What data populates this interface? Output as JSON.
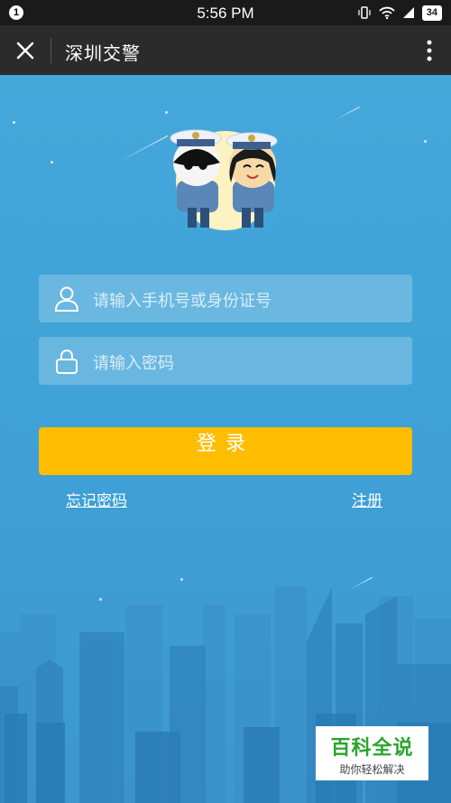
{
  "status_bar": {
    "notification_count": "1",
    "time": "5:56 PM",
    "battery": "34"
  },
  "app_bar": {
    "title": "深圳交警"
  },
  "login": {
    "username_placeholder": "请输入手机号或身份证号",
    "password_placeholder": "请输入密码",
    "login_label": "登录",
    "forgot_password": "忘记密码",
    "register": "注册"
  },
  "watermark": {
    "logo": "百科全说",
    "subtitle": "助你轻松解决"
  },
  "colors": {
    "background": "#46a9dc",
    "app_bar": "#2b2b2b",
    "login_button": "#ffbd00"
  }
}
